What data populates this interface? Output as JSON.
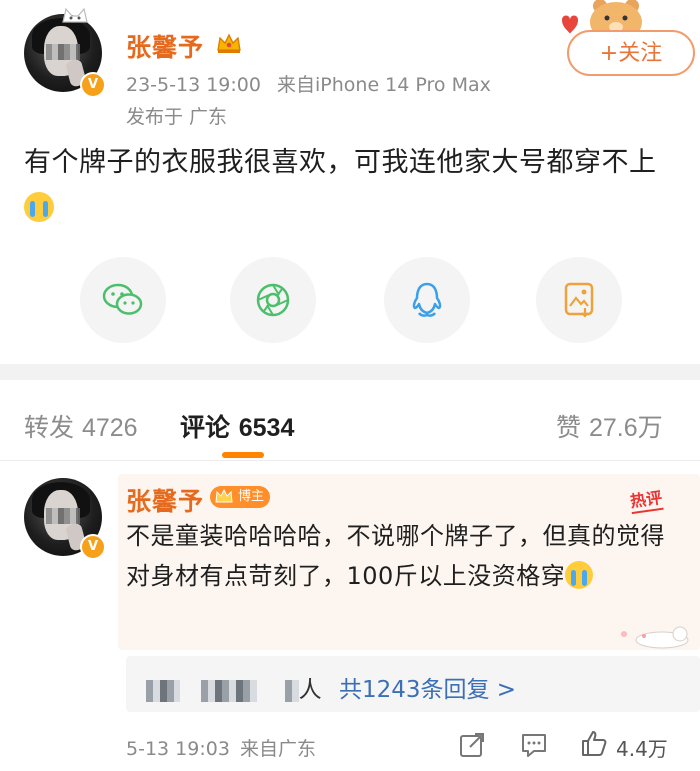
{
  "post": {
    "author": "张馨予",
    "timestamp": "23-5-13 19:00",
    "source": "来自iPhone 14 Pro Max",
    "location": "发布于 广东",
    "follow_label": "+关注",
    "text": "有个牌子的衣服我很喜欢，可我连他家大号都穿不上",
    "emoji": "crying-face"
  },
  "share_icons": [
    "wechat-icon",
    "moments-icon",
    "qq-icon",
    "save-image-icon"
  ],
  "tabs": {
    "repost_label": "转发",
    "repost_count": "4726",
    "comment_label": "评论",
    "comment_count": "6534",
    "like_label": "赞",
    "like_count": "27.6万"
  },
  "comment": {
    "author": "张馨予",
    "badge": "博主",
    "hot_tag": "热评",
    "text": "不是童装哈哈哈哈，不说哪个牌子了，但真的觉得对身材有点苛刻了，100斤以上没资格穿",
    "reply_summary_person": "人",
    "reply_summary_link": "共1243条回复 >",
    "timestamp": "5-13 19:03",
    "source": "来自广东",
    "like_count": "4.4万"
  },
  "colors": {
    "accent": "#ff8200",
    "username": "#e66a1e",
    "link": "#3b6fb6",
    "meta_gray": "#8a8a8a"
  }
}
